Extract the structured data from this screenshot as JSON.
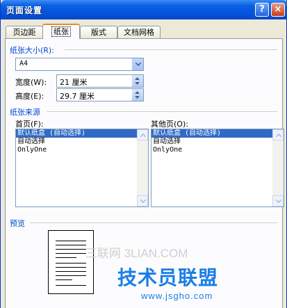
{
  "window": {
    "title": "页面设置",
    "help_label": "?",
    "close_label": "×"
  },
  "tabs": [
    {
      "label": "页边距"
    },
    {
      "label": "纸张"
    },
    {
      "label": "版式"
    },
    {
      "label": "文档网格"
    }
  ],
  "paper_size": {
    "group_label": "纸张大小(R):",
    "value": "A4",
    "width_label": "宽度(W):",
    "width_value": "21 厘米",
    "height_label": "高度(E):",
    "height_value": "29.7 厘米"
  },
  "paper_source": {
    "group_label": "纸张来源",
    "first_page_label": "首页(F):",
    "other_pages_label": "其他页(O):",
    "options": [
      "默认纸盒 (自动选择)",
      "自动选择",
      "OnlyOne"
    ],
    "first_page_selected": "默认纸盒 (自动选择)",
    "other_pages_selected": "默认纸盒 (自动选择)"
  },
  "preview": {
    "label": "预览"
  },
  "watermarks": {
    "site_cn": "技术员联盟",
    "site_url": "www.jsgho.com",
    "site_3l": "三联网 3LIAN.COM"
  }
}
